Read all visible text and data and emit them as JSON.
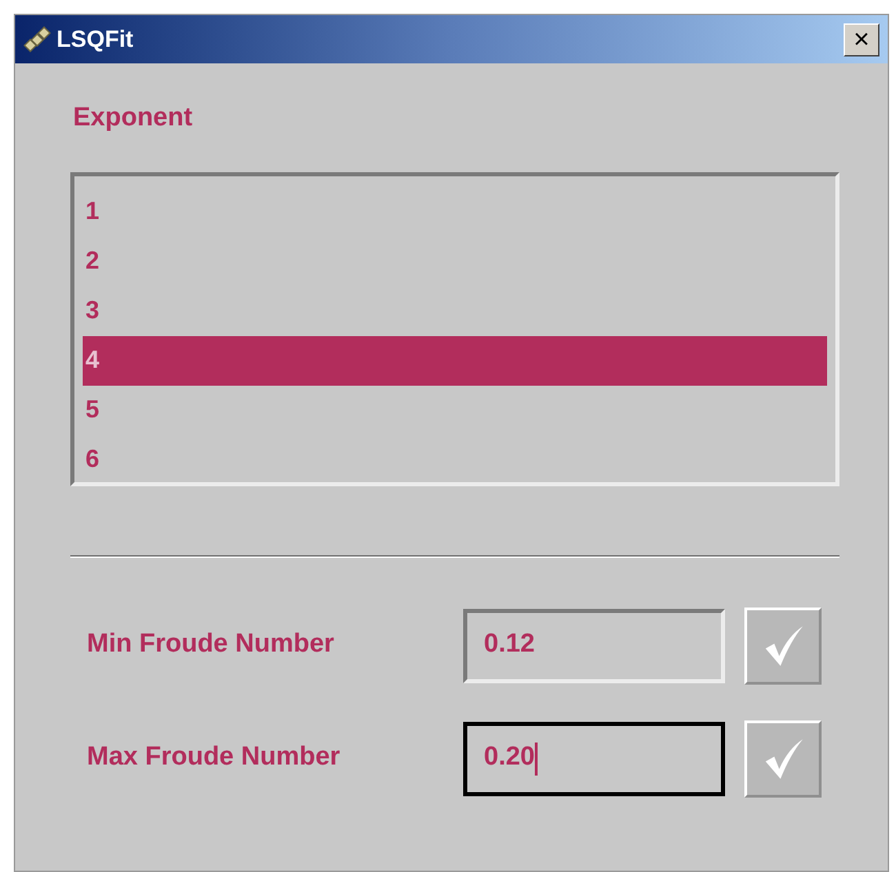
{
  "window": {
    "title": "LSQFit",
    "close": "×"
  },
  "exponent": {
    "label": "Exponent",
    "items": [
      {
        "label": "1",
        "selected": false
      },
      {
        "label": "2",
        "selected": false
      },
      {
        "label": "3",
        "selected": false
      },
      {
        "label": "4",
        "selected": true
      },
      {
        "label": "5",
        "selected": false
      },
      {
        "label": "6",
        "selected": false
      }
    ]
  },
  "fields": [
    {
      "label": "Min Froude Number",
      "value": "0.12",
      "focused": false
    },
    {
      "label": "Max Froude Number",
      "value": "0.20",
      "focused": true
    }
  ]
}
